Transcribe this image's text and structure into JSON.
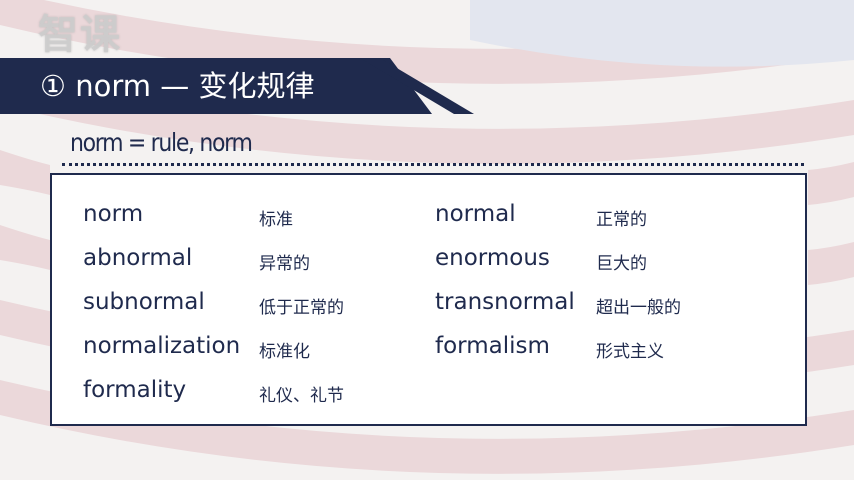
{
  "watermark": "智课",
  "banner": {
    "title": "① norm — 变化规律"
  },
  "subtitle": "norm = rule, norm",
  "vocab": {
    "left": [
      {
        "word": "norm",
        "meaning": "标准"
      },
      {
        "word": "abnormal",
        "meaning": "异常的"
      },
      {
        "word": "subnormal",
        "meaning": "低于正常的"
      },
      {
        "word": "normalization",
        "meaning": "标准化"
      },
      {
        "word": "formality",
        "meaning": "礼仪、礼节"
      }
    ],
    "right": [
      {
        "word": "normal",
        "meaning": "正常的"
      },
      {
        "word": "enormous",
        "meaning": "巨大的"
      },
      {
        "word": "transnormal",
        "meaning": "超出一般的"
      },
      {
        "word": "formalism",
        "meaning": "形式主义"
      }
    ]
  },
  "colors": {
    "navy": "#1f2a4d",
    "flag_red": "#e9d6d8",
    "flag_blue": "#dfe3ee",
    "background": "#f4f2f1"
  }
}
